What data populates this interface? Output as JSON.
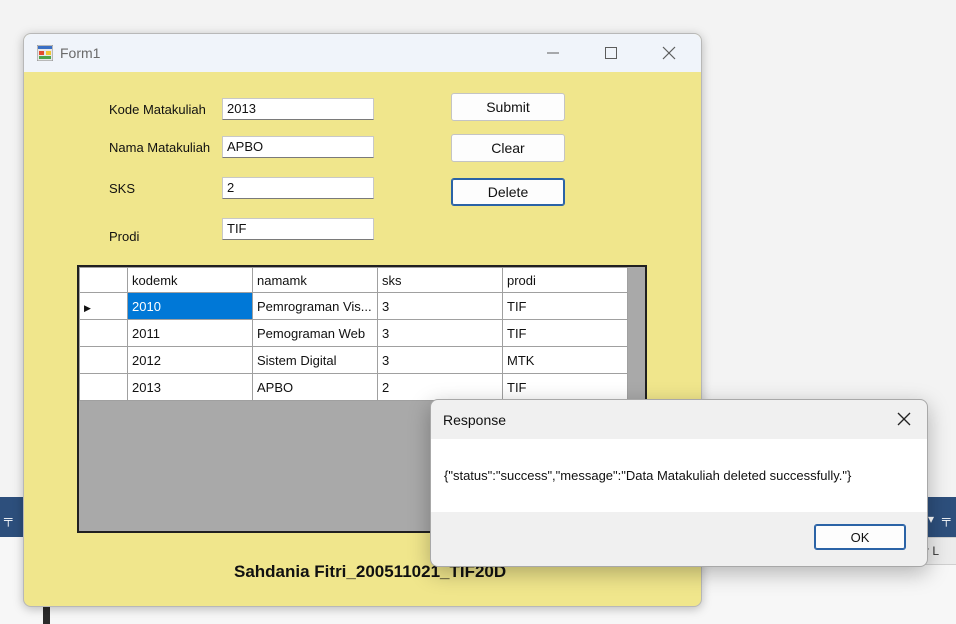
{
  "window": {
    "title": "Form1"
  },
  "form": {
    "fields": [
      {
        "label": "Kode Matakuliah",
        "value": "2013"
      },
      {
        "label": "Nama Matakuliah",
        "value": "APBO"
      },
      {
        "label": "SKS",
        "value": "2"
      },
      {
        "label": "Prodi",
        "value": "TIF"
      }
    ],
    "buttons": {
      "submit": "Submit",
      "clear": "Clear",
      "delete": "Delete"
    }
  },
  "grid": {
    "columns": [
      "kodemk",
      "namamk",
      "sks",
      "prodi"
    ],
    "rows": [
      [
        "2010",
        "Pemrograman Vis...",
        "3",
        "TIF"
      ],
      [
        "2011",
        "Pemograman Web",
        "3",
        "TIF"
      ],
      [
        "2012",
        "Sistem Digital",
        "3",
        "MTK"
      ],
      [
        "2013",
        "APBO",
        "2",
        "TIF"
      ]
    ],
    "current_row_marker": "▶"
  },
  "footer": {
    "text": "Sahdania Fitri_200511021_TIF20D"
  },
  "dialog": {
    "title": "Response",
    "message": "{\"status\":\"success\",\"message\":\"Data Matakuliah deleted successfully.\"}",
    "ok_label": "OK"
  },
  "background": {
    "right_panel_text": "r L"
  },
  "colors": {
    "form_bg": "#f0e68c",
    "selection": "#0078d7",
    "grid_bg": "#a9a9a9"
  }
}
